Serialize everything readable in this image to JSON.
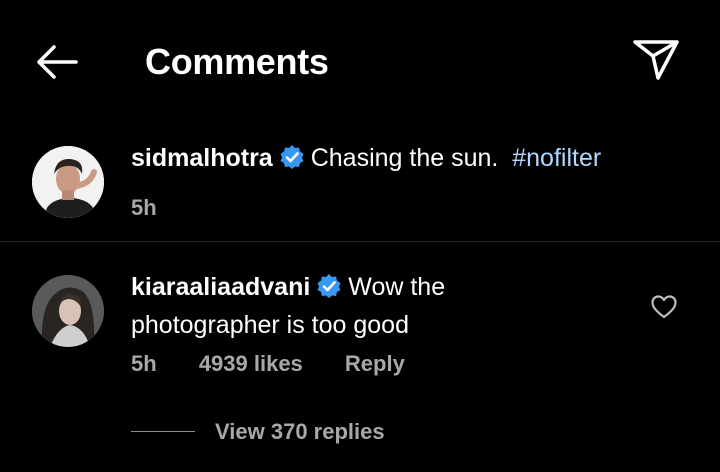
{
  "header": {
    "title": "Comments",
    "back_icon": "arrow-left-icon",
    "share_icon": "paper-plane-icon"
  },
  "caption": {
    "username": "sidmalhotra",
    "verified": true,
    "text": "Chasing the sun.",
    "hashtag": "#nofilter",
    "time": "5h"
  },
  "comments": [
    {
      "username": "kiaraaliaadvani",
      "verified": true,
      "text_line1": "Wow the",
      "text_line2": "photographer is too good",
      "time": "5h",
      "likes": "4939 likes",
      "reply_label": "Reply",
      "view_replies": "View 370 replies"
    }
  ],
  "colors": {
    "background": "#000000",
    "text": "#ffffff",
    "secondary_text": "#a8a8a8",
    "hashtag": "#b2d6ff",
    "verified_badge": "#3897f0",
    "divider": "#262626"
  }
}
